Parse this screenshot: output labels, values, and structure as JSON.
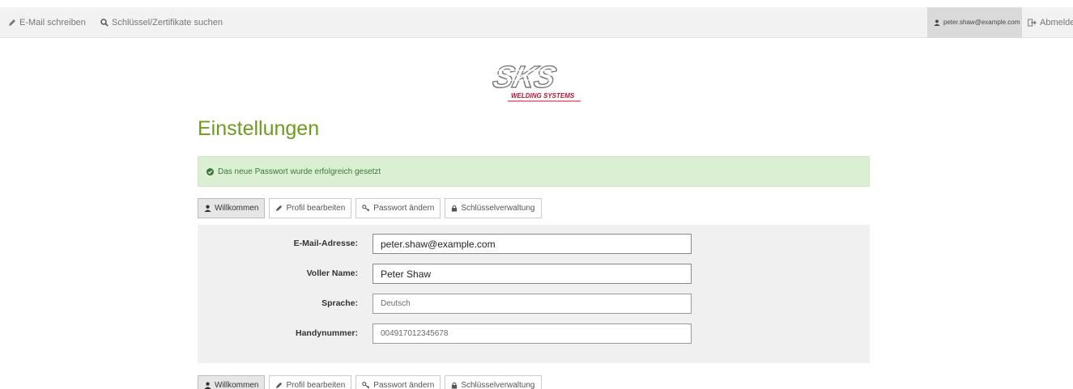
{
  "nav": {
    "compose_label": "E-Mail schreiben",
    "search_label": "Schlüssel/Zertifikate suchen",
    "user_label": "peter.shaw@example.com",
    "logout_label": "Abmelden"
  },
  "logo": {
    "brand": "SKS",
    "tagline": "WELDING SYSTEMS",
    "color": "#c8102e"
  },
  "page": {
    "title": "Einstellungen"
  },
  "alert": {
    "message": "Das neue Passwort wurde erfolgreich gesetzt",
    "color": "#3c763d"
  },
  "tabs": [
    {
      "label": "Willkommen",
      "icon": "user-icon",
      "active": true
    },
    {
      "label": "Profil bearbeiten",
      "icon": "pencil-icon",
      "active": false
    },
    {
      "label": "Passwort ändern",
      "icon": "key-icon",
      "active": false
    },
    {
      "label": "Schlüsselverwaltung",
      "icon": "lock-icon",
      "active": false
    }
  ],
  "form": {
    "email": {
      "label": "E-Mail-Adresse:",
      "value": "peter.shaw@example.com"
    },
    "name": {
      "label": "Voller Name:",
      "value": "Peter Shaw"
    },
    "language": {
      "label": "Sprache:",
      "value": "Deutsch"
    },
    "mobile": {
      "label": "Handynummer:",
      "value": "004917012345678"
    }
  },
  "colors": {
    "title": "#6f9b1f",
    "alert_bg": "#dbf0d2",
    "panel_bg": "#f0f0f0"
  }
}
